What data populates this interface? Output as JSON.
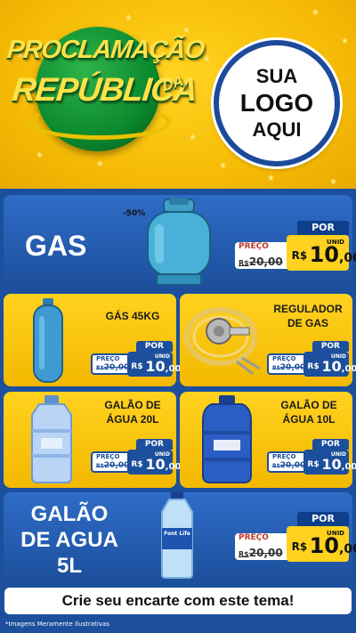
{
  "header": {
    "headline_line1": "PROCLAMAÇÃO",
    "headline_line2": "REPÚBLICA",
    "headline_da": "DA",
    "logo_line1": "SUA",
    "logo_line2": "LOGO",
    "logo_line3": "AQUI"
  },
  "colors": {
    "accent_yellow": "#f2b705",
    "accent_blue": "#1c4f9c",
    "accent_green": "#0b8a2e"
  },
  "products": {
    "gas": {
      "title": "GAS",
      "badge": "-50%",
      "preco_label": "PREÇO",
      "por_label": "POR",
      "old_price_prefix": "R$",
      "old_price": "20,00",
      "currency": "R$",
      "price_int": "10",
      "price_cents": ",00",
      "unit": "UNID"
    },
    "gas45": {
      "title": "GÁS 45KG",
      "preco_label": "PREÇO",
      "por_label": "POR",
      "old_price_prefix": "R$",
      "old_price": "20,00",
      "currency": "R$",
      "price_int": "10",
      "price_cents": ",00",
      "unit": "UNID"
    },
    "regulador": {
      "title_line1": "REGULADOR",
      "title_line2": "DE GAS",
      "preco_label": "PREÇO",
      "por_label": "POR",
      "old_price_prefix": "R$",
      "old_price": "20,00",
      "currency": "R$",
      "price_int": "10",
      "price_cents": ",00",
      "unit": "UNID"
    },
    "galao20": {
      "title_line1": "GALÃO DE",
      "title_line2": "ÁGUA 20L",
      "preco_label": "PREÇO",
      "por_label": "POR",
      "old_price_prefix": "R$",
      "old_price": "20,00",
      "currency": "R$",
      "price_int": "10",
      "price_cents": ",00",
      "unit": "UNID"
    },
    "galao10": {
      "title_line1": "GALÃO DE",
      "title_line2": "ÁGUA 10L",
      "preco_label": "PREÇO",
      "por_label": "POR",
      "old_price_prefix": "R$",
      "old_price": "20,00",
      "currency": "R$",
      "price_int": "10",
      "price_cents": ",00",
      "unit": "UNID"
    },
    "galao5": {
      "title_line1": "GALÃO",
      "title_line2": "DE AGUA",
      "title_line3": "5L",
      "bottle_label": "Font Life",
      "preco_label": "PREÇO",
      "por_label": "POR",
      "old_price_prefix": "R$",
      "old_price": "20,00",
      "currency": "R$",
      "price_int": "10",
      "price_cents": ",00",
      "unit": "UNID"
    }
  },
  "footer": {
    "cta": "Crie seu encarte com este tema!",
    "disclaimer": "*Imagens Meramente Ilustrativas"
  }
}
